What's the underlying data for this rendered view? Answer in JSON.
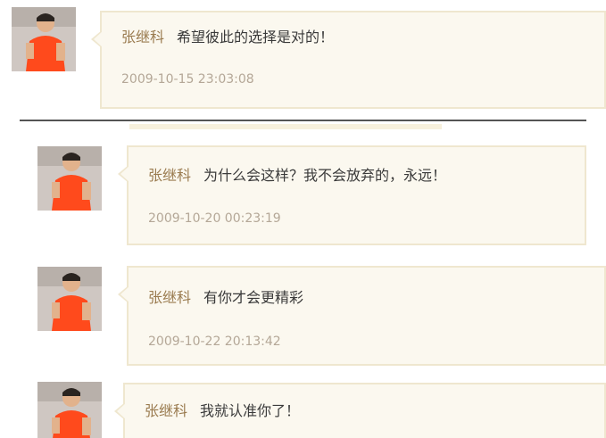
{
  "comments": [
    {
      "author": "张继科",
      "message": "希望彼此的选择是对的！",
      "time": "2009-10-15 23:03:08"
    },
    {
      "author": "张继科",
      "message": "为什么会这样？我不会放弃的，永远！",
      "time": "2009-10-20 00:23:19"
    },
    {
      "author": "张继科",
      "message": "有你才会更精彩",
      "time": "2009-10-22 20:13:42"
    },
    {
      "author": "张继科",
      "message": "我就认准你了！",
      "time": ""
    }
  ],
  "colors": {
    "author": "#9a7b4f",
    "message": "#3a3a3a",
    "time": "#b4a797",
    "bubble_bg": "#fbf8ef",
    "bubble_border": "#efe7cf"
  }
}
